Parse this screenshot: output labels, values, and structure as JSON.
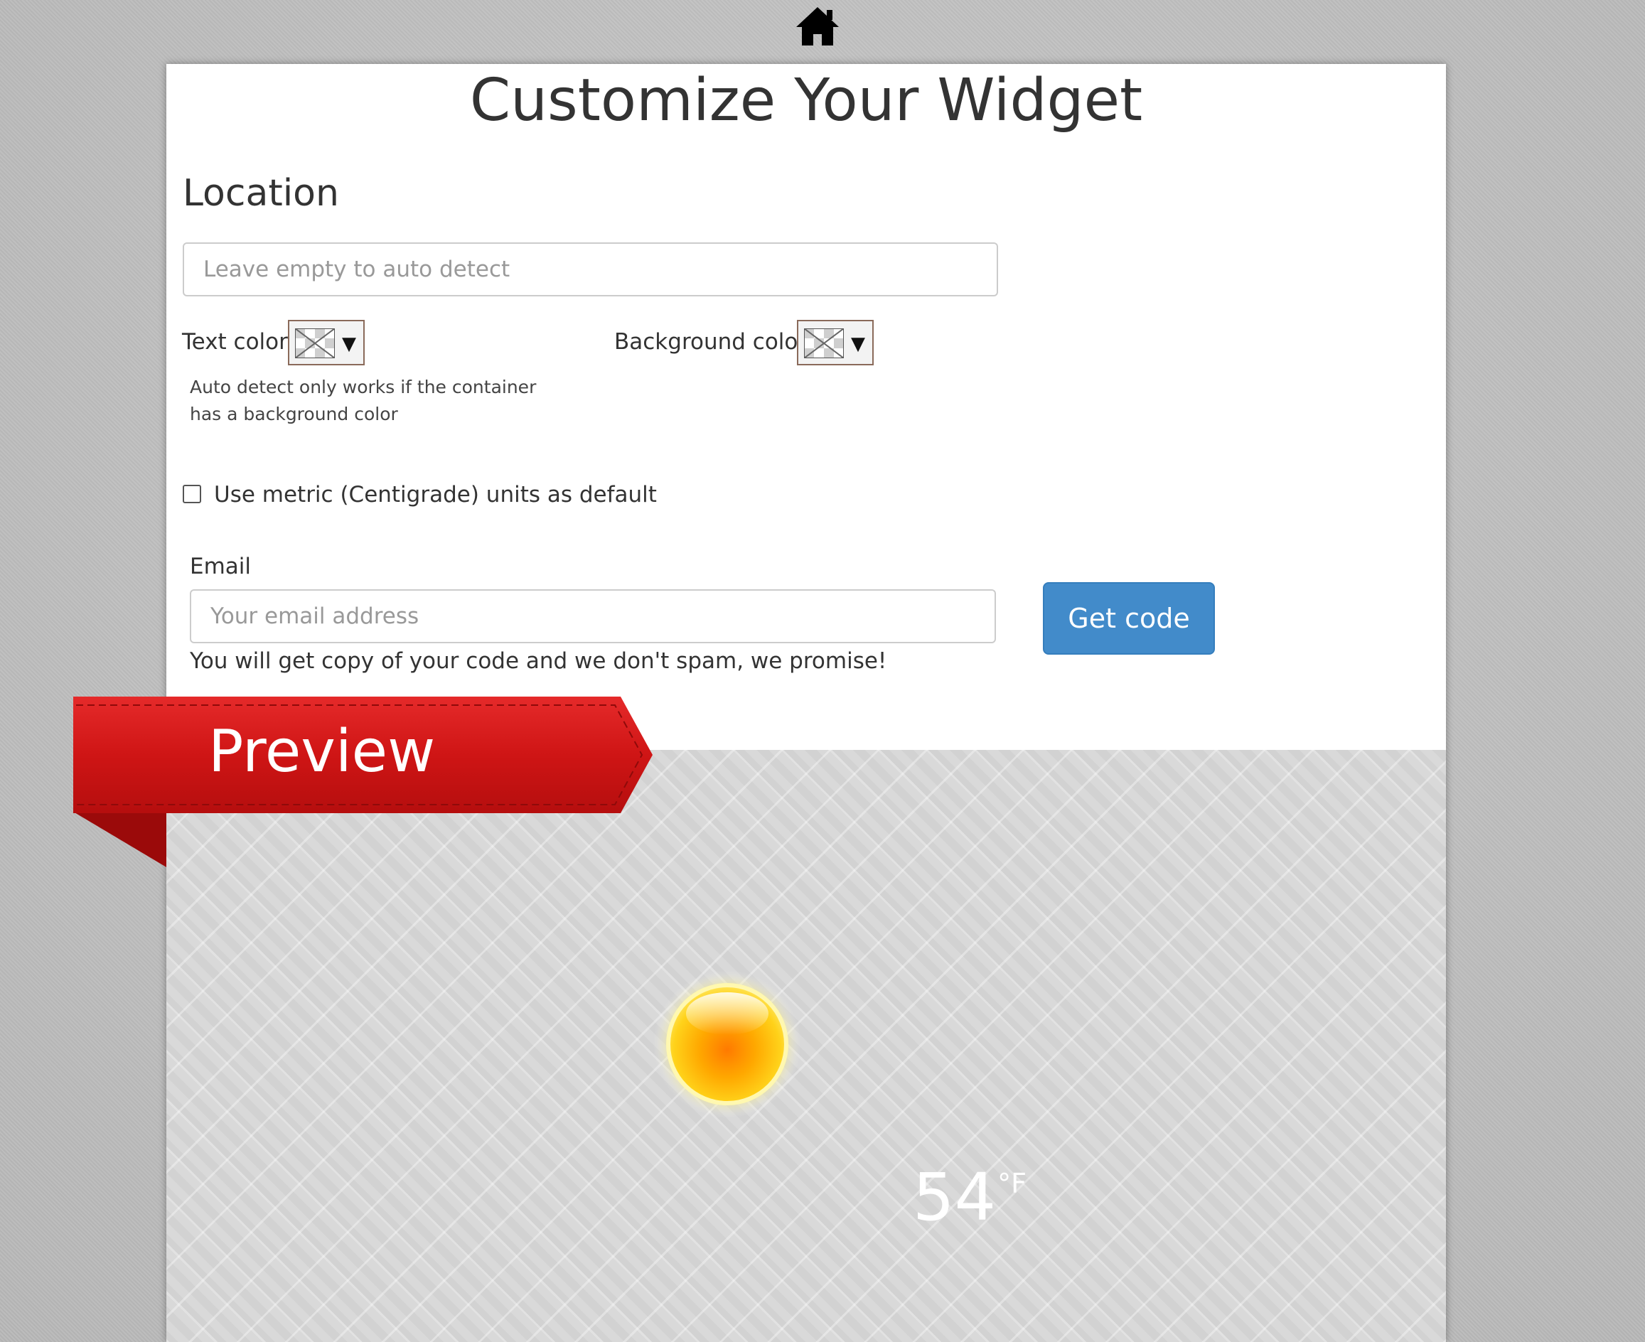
{
  "header": {
    "home_icon": "home-icon"
  },
  "page": {
    "title": "Customize Your Widget"
  },
  "location": {
    "heading": "Location",
    "value": "",
    "placeholder": "Leave empty to auto detect"
  },
  "colors": {
    "text_color_label": "Text color",
    "background_color_label": "Background color",
    "dropdown_arrow": "▼",
    "auto_detect_note": "Auto detect only works if the container has a background color"
  },
  "units": {
    "metric_label": "Use metric (Centigrade) units as default",
    "metric_checked": false
  },
  "email": {
    "label": "Email",
    "value": "",
    "placeholder": "Your email address",
    "note": "You will get copy of your code and we don't spam, we promise!",
    "submit_label": "Get code"
  },
  "preview": {
    "ribbon_label": "Preview",
    "weather_icon": "sun-icon",
    "temperature": "54",
    "unit": "°F"
  },
  "theme": {
    "accent": "#428bca",
    "ribbon_red": "#d01818",
    "page_background": "#bdbdbd",
    "preview_background": "#d9d9d9"
  }
}
